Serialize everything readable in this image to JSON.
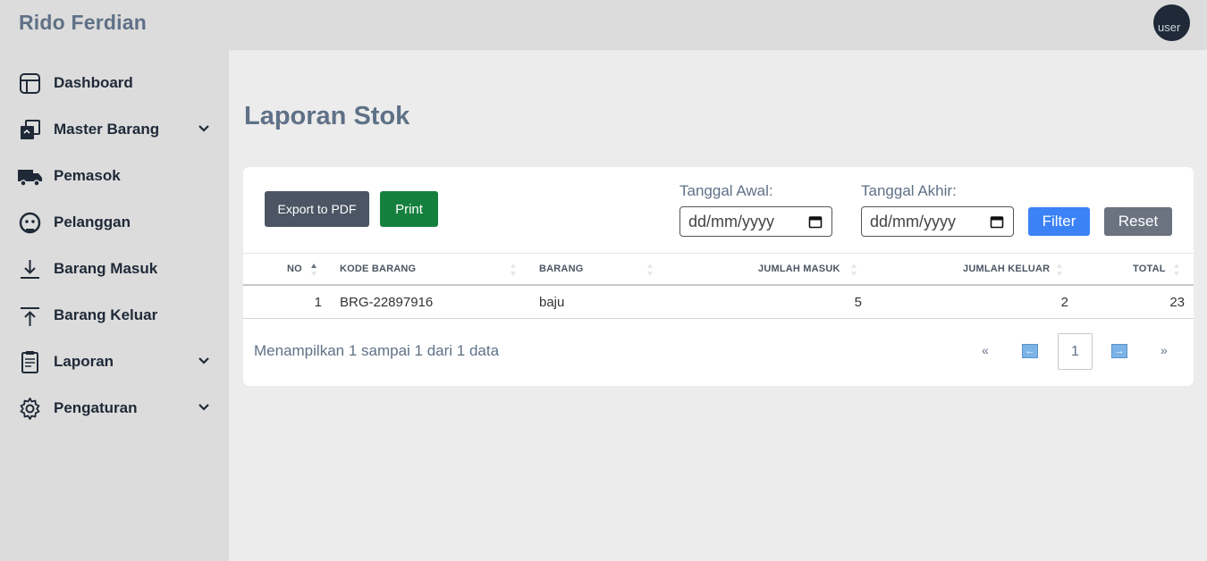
{
  "app": {
    "title": "Rido Ferdian",
    "avatar_alt": "user"
  },
  "sidebar": {
    "items": [
      {
        "label": "Dashboard",
        "icon": "dashboard-icon",
        "has_submenu": false
      },
      {
        "label": "Master Barang",
        "icon": "copy-icon",
        "has_submenu": true
      },
      {
        "label": "Pemasok",
        "icon": "truck-icon",
        "has_submenu": false
      },
      {
        "label": "Pelanggan",
        "icon": "customer-icon",
        "has_submenu": false
      },
      {
        "label": "Barang Masuk",
        "icon": "download-arrow-icon",
        "has_submenu": false
      },
      {
        "label": "Barang Keluar",
        "icon": "upload-arrow-icon",
        "has_submenu": false
      },
      {
        "label": "Laporan",
        "icon": "clipboard-icon",
        "has_submenu": true
      },
      {
        "label": "Pengaturan",
        "icon": "gear-icon",
        "has_submenu": true
      }
    ]
  },
  "page": {
    "title": "Laporan Stok"
  },
  "toolbar": {
    "export_label": "Export to PDF",
    "print_label": "Print",
    "start_date_label": "Tanggal Awal:",
    "end_date_label": "Tanggal Akhir:",
    "date_placeholder": "dd/mm/yyyy",
    "filter_label": "Filter",
    "reset_label": "Reset"
  },
  "table": {
    "columns": [
      "NO",
      "KODE BARANG",
      "BARANG",
      "JUMLAH MASUK",
      "JUMLAH KELUAR",
      "TOTAL"
    ],
    "rows": [
      [
        "1",
        "BRG-22897916",
        "baju",
        "5",
        "2",
        "23"
      ]
    ]
  },
  "pagination": {
    "info": "Menampilkan 1 sampai 1 dari 1 data",
    "first": "«",
    "prev": "←",
    "current": "1",
    "next": "→",
    "last": "»"
  },
  "colors": {
    "accent": "#3b82f6",
    "print": "#15803d",
    "dark_button": "#4b5563",
    "title": "#5f7187"
  }
}
